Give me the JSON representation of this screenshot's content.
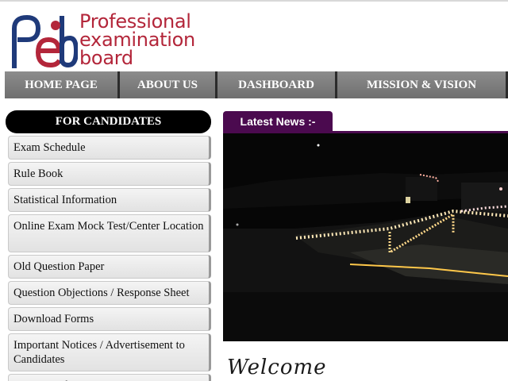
{
  "header": {
    "logo_line1": "Professional",
    "logo_line2": "examination",
    "logo_line3": "board",
    "brand_color": "#b3263a",
    "mark_color": "#1f3a7a"
  },
  "nav": {
    "items": [
      "HOME PAGE",
      "ABOUT US",
      "DASHBOARD",
      "MISSION & VISION"
    ]
  },
  "sidebar": {
    "title": "FOR CANDIDATES",
    "items": [
      "Exam Schedule",
      "Rule Book",
      "Statistical Information",
      "Online Exam Mock Test/Center Location",
      "Old Question Paper",
      "Question Objections / Response Sheet",
      "Download Forms",
      "Important Notices / Advertisement to Candidates",
      "Right to Information"
    ]
  },
  "news": {
    "title": "Latest News :-",
    "accent": "#4b0a4f"
  },
  "photo": {
    "subject": "building-lit-with-lights-at-night"
  },
  "welcome": {
    "text": "Welcome"
  }
}
